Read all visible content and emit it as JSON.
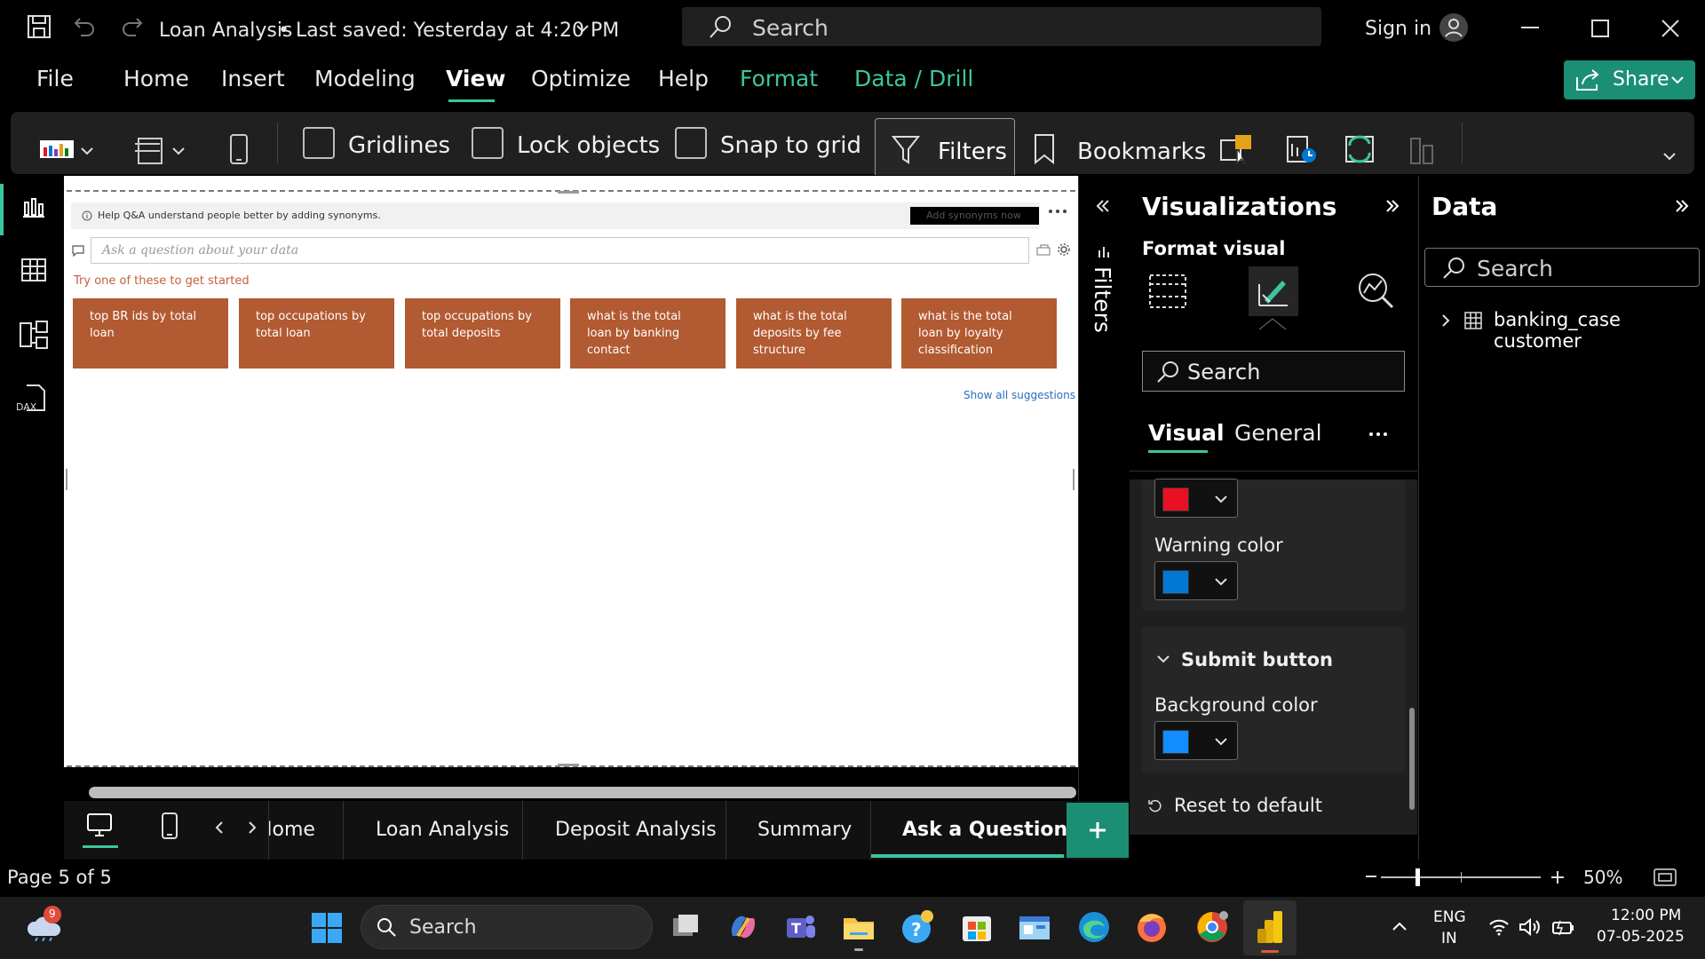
{
  "titlebar": {
    "doc_title": "Loan Analysis",
    "saved": "•  Last saved: Yesterday at 4:20 PM",
    "search_placeholder": "Search",
    "sign_in": "Sign in"
  },
  "menu": {
    "file": "File",
    "home": "Home",
    "insert": "Insert",
    "modeling": "Modeling",
    "view": "View",
    "optimize": "Optimize",
    "help": "Help",
    "format": "Format",
    "data_drill": "Data / Drill",
    "share": "Share"
  },
  "ribbon": {
    "gridlines": "Gridlines",
    "lock_objects": "Lock objects",
    "snap_to_grid": "Snap to grid",
    "filters": "Filters",
    "bookmarks": "Bookmarks"
  },
  "qa": {
    "banner": "Help Q&A understand people better by adding synonyms.",
    "add_synonyms": "Add synonyms now",
    "input_placeholder": "Ask a question about your data",
    "try_text": "Try one of these to get started",
    "suggestions": [
      "top BR ids by total loan",
      "top occupations by total loan",
      "top occupations by total deposits",
      "what is the total loan by banking contact",
      "what is the total deposits by fee structure",
      "what is the total loan by loyalty classification"
    ],
    "show_all": "Show all suggestions"
  },
  "filters_pane": {
    "label": "Filters"
  },
  "viz": {
    "title": "Visualizations",
    "format_visual": "Format visual",
    "search_placeholder": "Search",
    "tab_visual": "Visual",
    "tab_general": "General",
    "warning_color_label": "Warning color",
    "submit_button": "Submit button",
    "background_color_label": "Background color",
    "reset": "Reset to default",
    "colors": {
      "error": "#e81123",
      "warning": "#0078d4",
      "background": "#118dff"
    }
  },
  "data_pane": {
    "title": "Data",
    "search_placeholder": "Search",
    "table": "banking_case customer"
  },
  "pages": {
    "tabs": [
      "Home",
      "Loan Analysis",
      "Deposit Analysis",
      "Summary",
      "Ask a Question"
    ],
    "active": "Ask a Question",
    "page_info": "Page 5 of 5",
    "zoom": "50%"
  },
  "taskbar": {
    "search": "Search",
    "weather_badge": "9",
    "lang1": "ENG",
    "lang2": "IN",
    "time": "12:00 PM",
    "date": "07-05-2025"
  }
}
